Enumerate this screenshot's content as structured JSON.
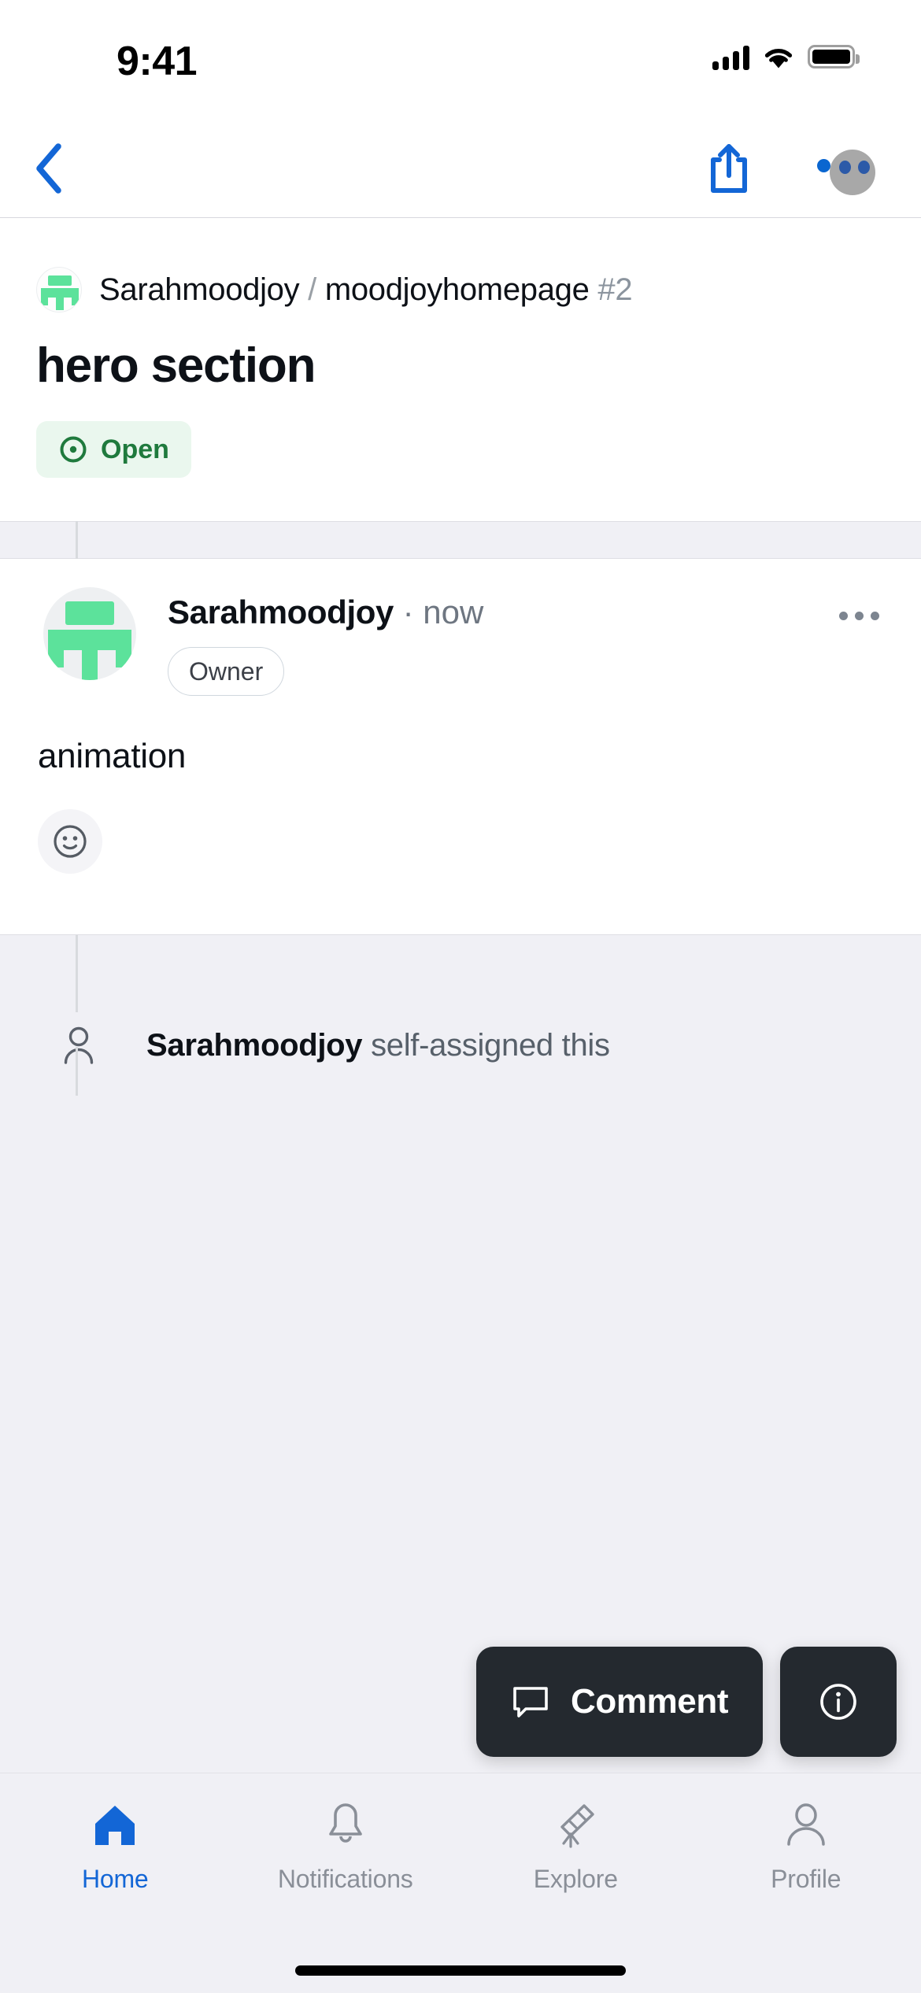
{
  "status_bar": {
    "time": "9:41",
    "cellular_icon": "signal-bars-icon",
    "wifi_icon": "wifi-icon",
    "battery_icon": "battery-icon"
  },
  "nav_bar": {
    "back_icon": "chevron-left-icon",
    "share_icon": "share-icon",
    "avatar_icon": "user-avatar-icon",
    "notification_dot": "notification-dot"
  },
  "issue_header": {
    "repo_avatar_icon": "repo-owner-avatar-icon",
    "owner": "Sarahmoodjoy",
    "separator": "/",
    "repo": "moodjoyhomepage",
    "issue_number": "#2",
    "title": "hero section",
    "state": {
      "label": "Open",
      "icon": "issue-opened-icon",
      "text_color": "#1f7a3d",
      "background_color": "#eaf7ee"
    }
  },
  "comment": {
    "avatar_icon": "comment-author-avatar-icon",
    "author": "Sarahmoodjoy",
    "timestamp_separator": "·",
    "timestamp": "now",
    "role_badge": "Owner",
    "overflow_icon": "kebab-menu-icon",
    "body": "animation",
    "reaction_icon": "add-reaction-smiley-icon"
  },
  "timeline_event": {
    "icon": "person-icon",
    "actor": "Sarahmoodjoy",
    "action": "self-assigned this"
  },
  "actions": {
    "comment_label": "Comment",
    "comment_icon": "comment-bubble-icon",
    "info_icon": "info-circle-icon",
    "background_color": "#24292f"
  },
  "tab_bar": {
    "active_color": "#1366d6",
    "inactive_color": "#8a8f98",
    "tabs": [
      {
        "label": "Home",
        "icon": "home-icon",
        "active": true
      },
      {
        "label": "Notifications",
        "icon": "bell-icon",
        "active": false
      },
      {
        "label": "Explore",
        "icon": "telescope-icon",
        "active": false
      },
      {
        "label": "Profile",
        "icon": "person-outline-icon",
        "active": false
      }
    ]
  }
}
